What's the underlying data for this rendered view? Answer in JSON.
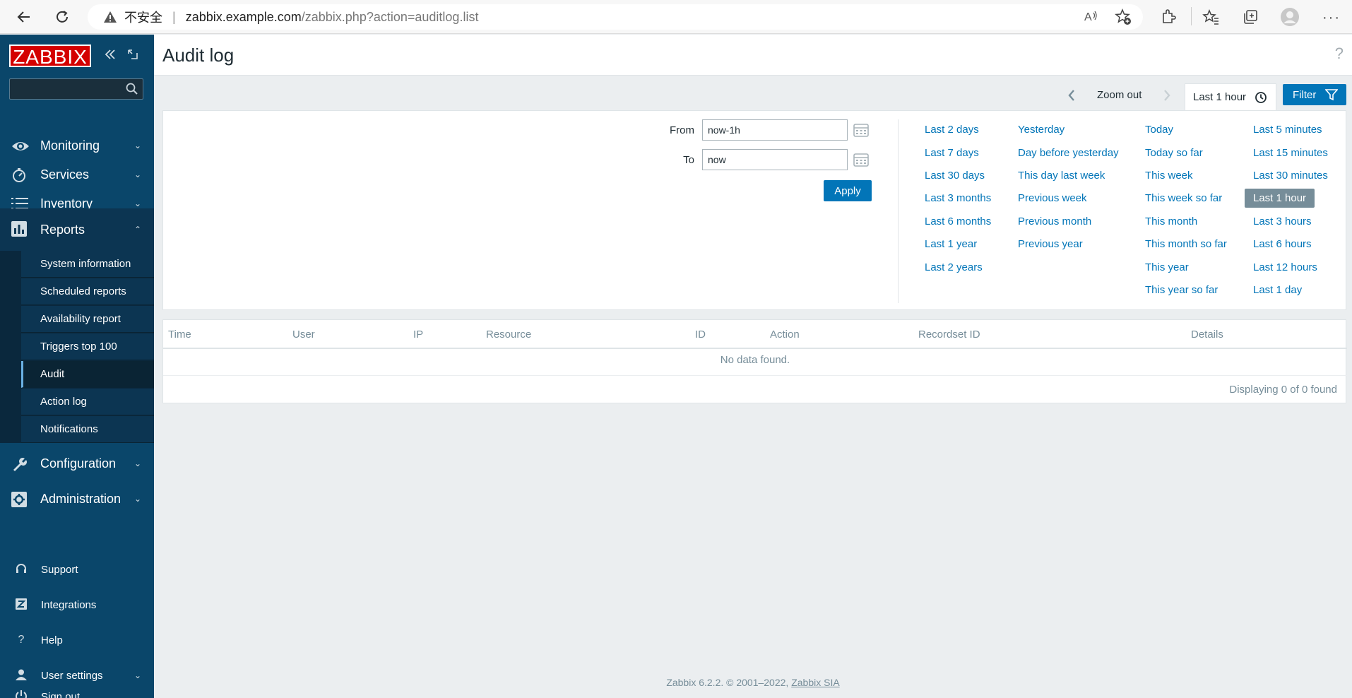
{
  "browser": {
    "security_label": "不安全",
    "url_domain": "zabbix.example.com",
    "url_path": "/zabbix.php?action=auditlog.list"
  },
  "sidebar": {
    "logo": "ZABBIX",
    "search_placeholder": "",
    "menu": [
      {
        "label": "Monitoring",
        "icon": "eye-icon",
        "expanded": false
      },
      {
        "label": "Services",
        "icon": "stopwatch-icon",
        "expanded": false
      },
      {
        "label": "Inventory",
        "icon": "list-icon",
        "expanded": false
      },
      {
        "label": "Reports",
        "icon": "bar-chart-icon",
        "expanded": true
      },
      {
        "label": "Configuration",
        "icon": "wrench-icon",
        "expanded": false
      },
      {
        "label": "Administration",
        "icon": "gear-icon",
        "expanded": false
      }
    ],
    "reports_submenu": [
      "System information",
      "Scheduled reports",
      "Availability report",
      "Triggers top 100",
      "Audit",
      "Action log",
      "Notifications"
    ],
    "active_submenu": "Audit",
    "bottom": [
      {
        "label": "Support",
        "icon": "headset-icon"
      },
      {
        "label": "Integrations",
        "icon": "zabbix-z-icon"
      },
      {
        "label": "Help",
        "icon": "question-icon"
      },
      {
        "label": "User settings",
        "icon": "user-icon"
      },
      {
        "label": "Sign out",
        "icon": "power-icon"
      }
    ]
  },
  "header": {
    "title": "Audit log",
    "help": "?"
  },
  "timebar": {
    "zoom_out": "Zoom out",
    "active_tab": "Last 1 hour",
    "filter_label": "Filter"
  },
  "filter": {
    "from_label": "From",
    "from_value": "now-1h",
    "to_label": "To",
    "to_value": "now",
    "apply_label": "Apply",
    "quick_ranges": {
      "col1": [
        "Last 2 days",
        "Last 7 days",
        "Last 30 days",
        "Last 3 months",
        "Last 6 months",
        "Last 1 year",
        "Last 2 years"
      ],
      "col2": [
        "Yesterday",
        "Day before yesterday",
        "This day last week",
        "Previous week",
        "Previous month",
        "Previous year"
      ],
      "col3": [
        "Today",
        "Today so far",
        "This week",
        "This week so far",
        "This month",
        "This month so far",
        "This year",
        "This year so far"
      ],
      "col4": [
        "Last 5 minutes",
        "Last 15 minutes",
        "Last 30 minutes",
        "Last 1 hour",
        "Last 3 hours",
        "Last 6 hours",
        "Last 12 hours",
        "Last 1 day"
      ]
    },
    "selected_range": "Last 1 hour"
  },
  "table": {
    "columns": [
      "Time",
      "User",
      "IP",
      "Resource",
      "ID",
      "Action",
      "Recordset ID",
      "Details"
    ],
    "empty_text": "No data found.",
    "paging": "Displaying 0 of 0 found"
  },
  "footer": {
    "text": "Zabbix 6.2.2. © 2001–2022,",
    "link": "Zabbix SIA"
  }
}
